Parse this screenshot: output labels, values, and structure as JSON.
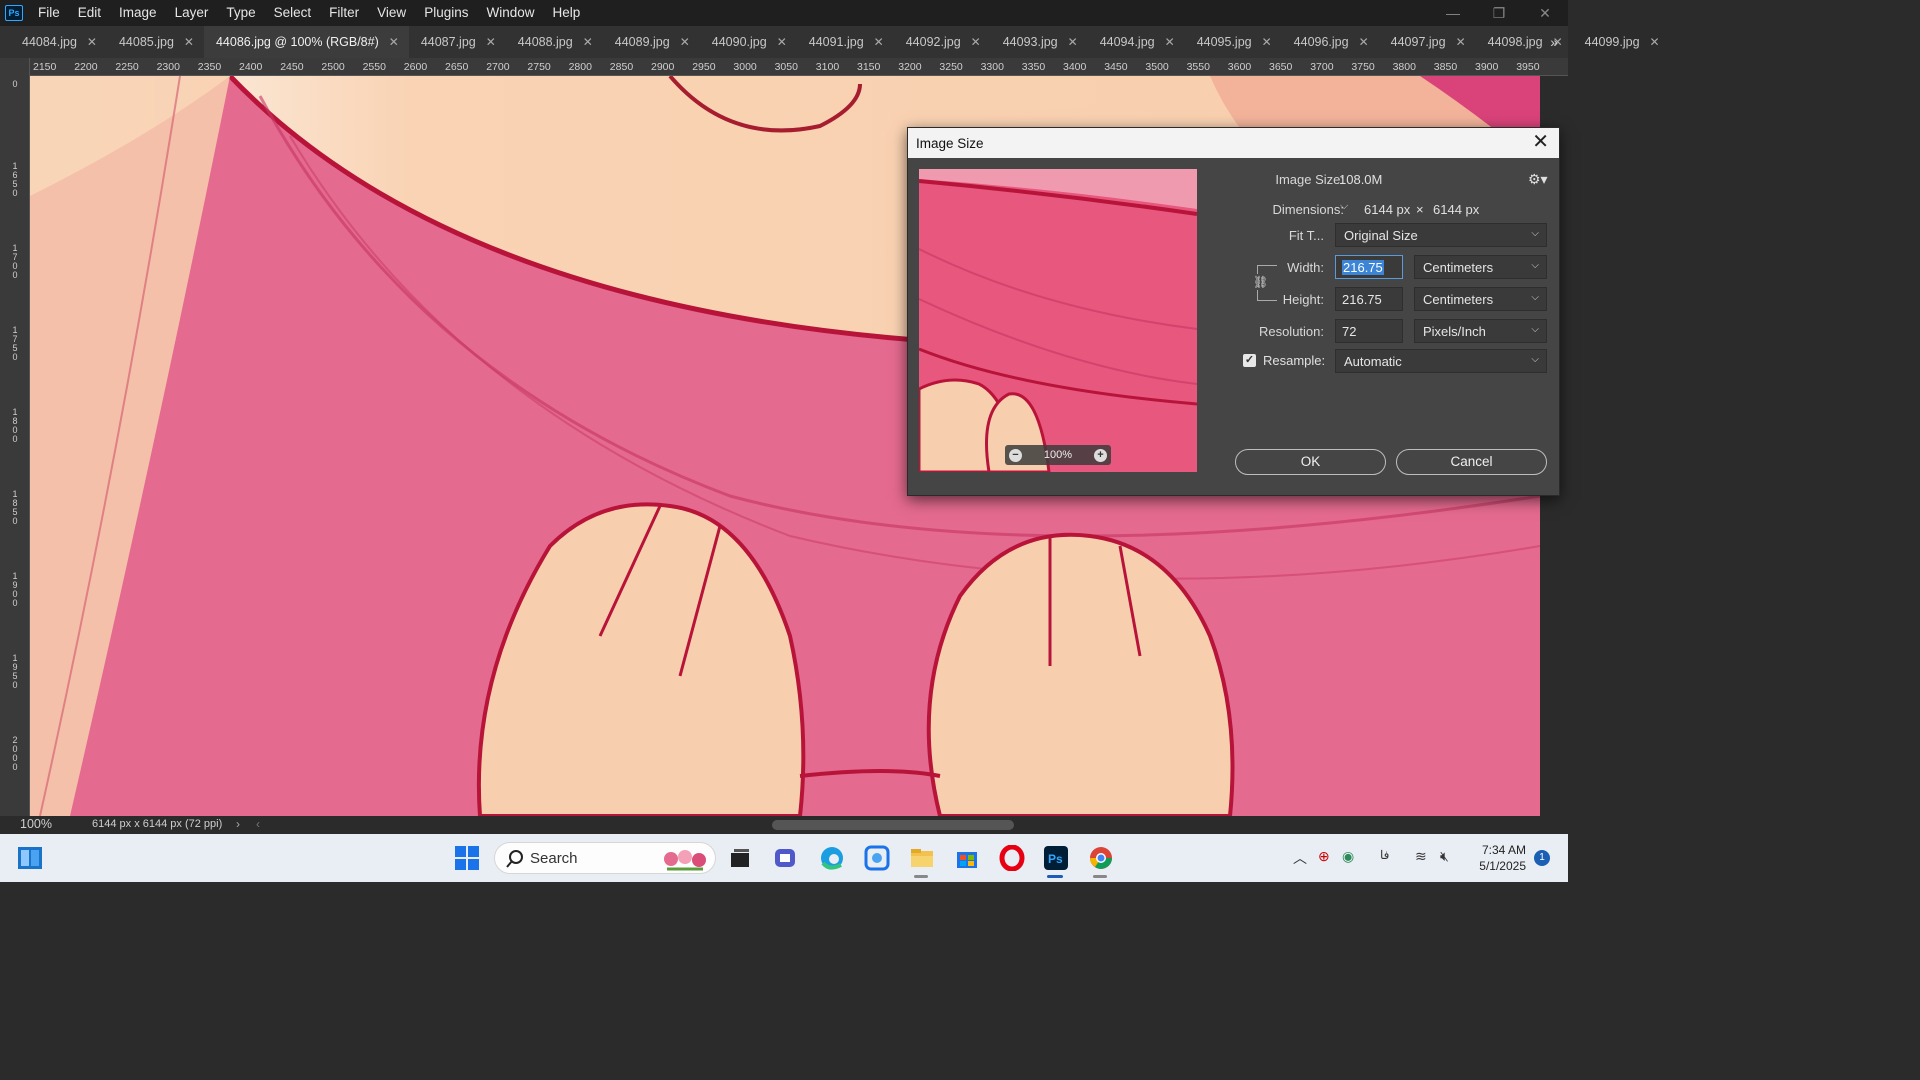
{
  "menubar": {
    "logo": "Ps",
    "items": [
      "File",
      "Edit",
      "Image",
      "Layer",
      "Type",
      "Select",
      "Filter",
      "View",
      "Plugins",
      "Window",
      "Help"
    ]
  },
  "tabs": [
    {
      "label": "44084.jpg",
      "active": false
    },
    {
      "label": "44085.jpg",
      "active": false
    },
    {
      "label": "44086.jpg @ 100% (RGB/8#)",
      "active": true
    },
    {
      "label": "44087.jpg",
      "active": false
    },
    {
      "label": "44088.jpg",
      "active": false
    },
    {
      "label": "44089.jpg",
      "active": false
    },
    {
      "label": "44090.jpg",
      "active": false
    },
    {
      "label": "44091.jpg",
      "active": false
    },
    {
      "label": "44092.jpg",
      "active": false
    },
    {
      "label": "44093.jpg",
      "active": false
    },
    {
      "label": "44094.jpg",
      "active": false
    },
    {
      "label": "44095.jpg",
      "active": false
    },
    {
      "label": "44096.jpg",
      "active": false
    },
    {
      "label": "44097.jpg",
      "active": false
    },
    {
      "label": "44098.jpg",
      "active": false
    },
    {
      "label": "44099.jpg",
      "active": false
    }
  ],
  "tab_more": "»",
  "ruler_top": [
    "2150",
    "2200",
    "2250",
    "2300",
    "2350",
    "2400",
    "2450",
    "2500",
    "2550",
    "2600",
    "2650",
    "2700",
    "2750",
    "2800",
    "2850",
    "2900",
    "2950",
    "3000",
    "3050",
    "3100",
    "3150",
    "3200",
    "3250",
    "3300",
    "3350",
    "3400",
    "3450",
    "3500",
    "3550",
    "3600",
    "3650",
    "3700",
    "3750",
    "3800",
    "3850",
    "3900",
    "3950"
  ],
  "ruler_left": [
    "0",
    "1650",
    "1700",
    "1750",
    "1800",
    "1850",
    "1900",
    "1950",
    "2000",
    "2050",
    "3000"
  ],
  "status": {
    "zoom": "100%",
    "doc_info": "6144 px x 6144 px (72 ppi)",
    "arrow": "›",
    "arrow_left": "‹"
  },
  "dialog": {
    "title": "Image Size",
    "close": "✕",
    "image_size_label": "Image Size:",
    "image_size_value": "108.0M",
    "dimensions_label": "Dimensions:",
    "dimensions_w": "6144 px",
    "dimensions_x": "×",
    "dimensions_h": "6144 px",
    "fit_label": "Fit T...",
    "fit_value": "Original Size",
    "width_label": "Width:",
    "width_value": "216.75",
    "width_unit": "Centimeters",
    "height_label": "Height:",
    "height_value": "216.75",
    "height_unit": "Centimeters",
    "resolution_label": "Resolution:",
    "resolution_value": "72",
    "resolution_unit": "Pixels/Inch",
    "resample_label": "Resample:",
    "resample_checked": true,
    "resample_value": "Automatic",
    "preview_zoom": "100%",
    "ok": "OK",
    "cancel": "Cancel"
  },
  "taskbar": {
    "search_placeholder": "Search",
    "time": "7:34 AM",
    "date": "5/1/2025",
    "notification_count": "1",
    "lang": "فا"
  },
  "colors": {
    "accent": "#31a8ff",
    "skin": "#f8cfae",
    "pink": "#e8577e",
    "outline": "#b8143a"
  }
}
